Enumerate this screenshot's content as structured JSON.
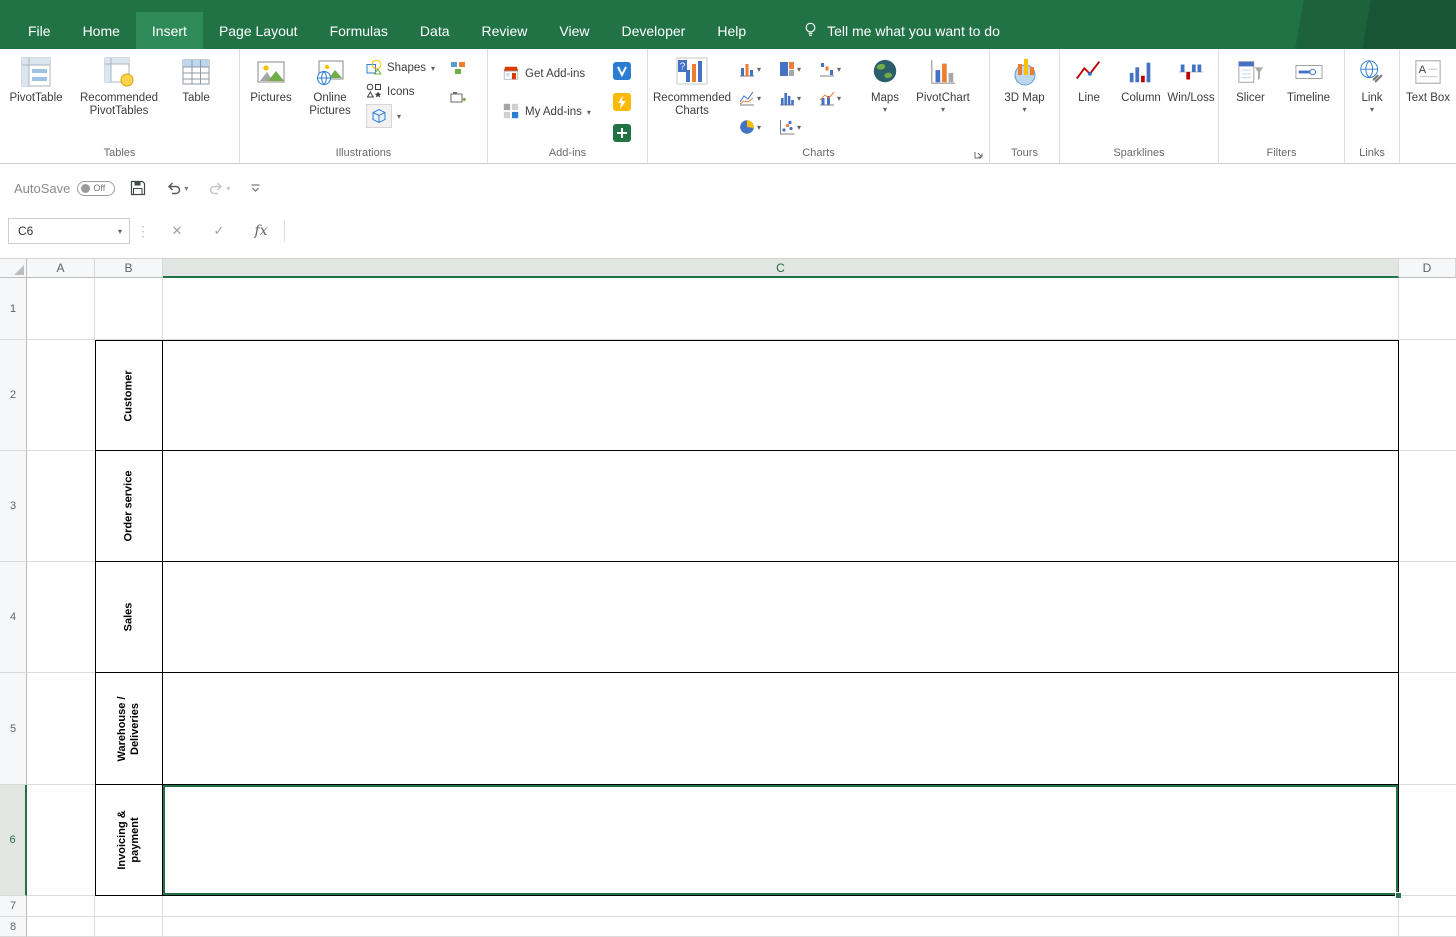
{
  "menubar": {
    "tabs": [
      {
        "label": "File"
      },
      {
        "label": "Home"
      },
      {
        "label": "Insert"
      },
      {
        "label": "Page Layout"
      },
      {
        "label": "Formulas"
      },
      {
        "label": "Data"
      },
      {
        "label": "Review"
      },
      {
        "label": "View"
      },
      {
        "label": "Developer"
      },
      {
        "label": "Help"
      }
    ],
    "active_tab": "Insert",
    "tell_me": "Tell me what you want to do"
  },
  "ribbon": {
    "tables": {
      "label": "Tables",
      "pivottable": "PivotTable",
      "recommended_pivottables": "Recommended PivotTables",
      "table": "Table"
    },
    "illustrations": {
      "label": "Illustrations",
      "pictures": "Pictures",
      "online_pictures": "Online Pictures",
      "shapes": "Shapes",
      "icons": "Icons"
    },
    "addins": {
      "label": "Add-ins",
      "get_addins": "Get Add-ins",
      "my_addins": "My Add-ins"
    },
    "charts": {
      "label": "Charts",
      "recommended_charts": "Recommended Charts",
      "maps": "Maps",
      "pivotchart": "PivotChart"
    },
    "tours": {
      "label": "Tours",
      "map3d": "3D Map"
    },
    "sparklines": {
      "label": "Sparklines",
      "line": "Line",
      "column": "Column",
      "winloss": "Win/Loss"
    },
    "filters": {
      "label": "Filters",
      "slicer": "Slicer",
      "timeline": "Timeline"
    },
    "links": {
      "label": "Links",
      "link": "Link"
    },
    "text": {
      "textbox": "Text Box"
    }
  },
  "quick_access": {
    "autosave": "AutoSave",
    "autosave_state": "Off"
  },
  "formula_bar": {
    "name_box": "C6",
    "fx": "fx",
    "formula": ""
  },
  "sheet": {
    "columns": [
      "A",
      "B",
      "C",
      "D"
    ],
    "rows": [
      "1",
      "2",
      "3",
      "4",
      "5",
      "6",
      "7",
      "8"
    ],
    "selected_cell": "C6",
    "selected_column": "C",
    "selected_row": "6",
    "lanes": [
      {
        "label": "Customer"
      },
      {
        "label": "Order service"
      },
      {
        "label": "Sales"
      },
      {
        "label": "Warehouse / Deliveries"
      },
      {
        "label": "Invoicing & payment"
      }
    ]
  },
  "colors": {
    "excel_green": "#217346",
    "selection_border": "#217346"
  },
  "icons": {
    "caret": "▾",
    "cancel": "✕",
    "check": "✓",
    "drag_dots": "⋮"
  }
}
